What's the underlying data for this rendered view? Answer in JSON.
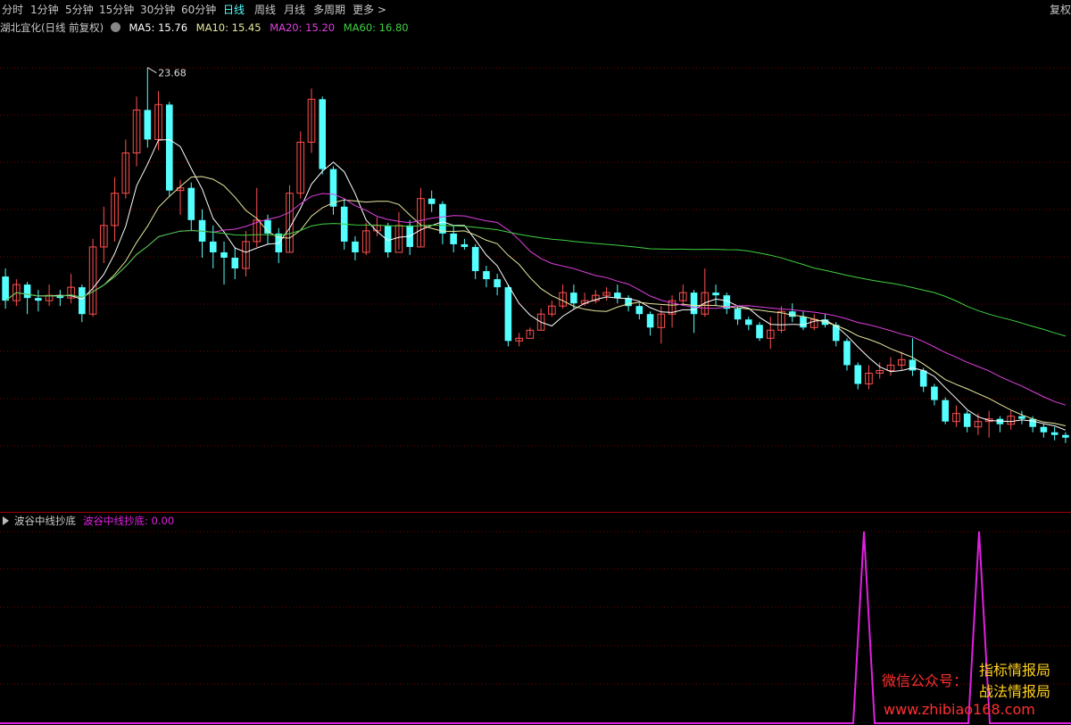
{
  "toolbar": {
    "items": [
      "分时",
      "1分钟",
      "5分钟",
      "15分钟",
      "30分钟",
      "60分钟",
      "日线",
      "周线",
      "月线",
      "多周期",
      "更多 >"
    ],
    "active_index": 6,
    "right_label": "复权"
  },
  "header": {
    "title": "湖北宜化(日线 前复权)",
    "ma5": "MA5: 15.76",
    "ma10": "MA10: 15.45",
    "ma20": "MA20: 15.20",
    "ma60": "MA60: 16.80",
    "colors": {
      "ma5": "#ffffff",
      "ma10": "#e8e8a0",
      "ma20": "#e040e0",
      "ma60": "#40d040"
    }
  },
  "price_annotation": "23.68",
  "indicator": {
    "name": "波谷中线抄底",
    "value_label": "波谷中线抄底: 0.00",
    "color": "#e020e0"
  },
  "watermark": {
    "line1_prefix": "微信公众号：",
    "line1_suffix": "指标情报局",
    "line2": "战法情报局",
    "line3": "www.zhibiao168.com"
  },
  "colors": {
    "up": "#ff5050",
    "down": "#54ffff",
    "bg": "#000000",
    "grid": "#7a0000"
  },
  "icons": [
    "gear-icon",
    "triangle-icon"
  ],
  "chart_data": {
    "type": "candlestick",
    "ma_series": [
      "MA5",
      "MA10",
      "MA20",
      "MA60"
    ],
    "max_price_label": 23.68,
    "indicator_signals": [
      2,
      2
    ],
    "candles": [
      [
        15.9,
        15.0,
        16.2,
        14.7
      ],
      [
        15.0,
        15.6,
        15.8,
        14.8
      ],
      [
        15.6,
        15.1,
        15.7,
        14.5
      ],
      [
        15.1,
        15.0,
        15.4,
        14.6
      ],
      [
        15.0,
        15.2,
        15.6,
        14.8
      ],
      [
        15.2,
        15.1,
        15.4,
        14.8
      ],
      [
        15.1,
        15.5,
        16.0,
        14.9
      ],
      [
        15.5,
        14.5,
        15.6,
        14.2
      ],
      [
        14.5,
        17.0,
        17.3,
        14.4
      ],
      [
        17.0,
        17.8,
        18.5,
        16.4
      ],
      [
        17.8,
        19.0,
        19.6,
        17.2
      ],
      [
        19.0,
        20.5,
        21.0,
        18.8
      ],
      [
        20.5,
        22.1,
        22.6,
        20.0
      ],
      [
        22.1,
        21.0,
        23.68,
        20.7
      ],
      [
        21.0,
        22.3,
        22.8,
        20.6
      ],
      [
        22.3,
        19.1,
        22.4,
        18.9
      ],
      [
        19.1,
        19.2,
        19.5,
        18.2
      ],
      [
        19.2,
        18.0,
        19.4,
        17.6
      ],
      [
        18.0,
        17.2,
        18.4,
        16.6
      ],
      [
        17.2,
        16.8,
        17.8,
        16.2
      ],
      [
        16.8,
        16.6,
        17.2,
        15.6
      ],
      [
        16.6,
        16.2,
        17.0,
        15.8
      ],
      [
        16.2,
        17.2,
        17.6,
        15.9
      ],
      [
        17.2,
        18.0,
        19.2,
        17.0
      ],
      [
        18.0,
        17.5,
        18.2,
        17.1
      ],
      [
        17.5,
        16.8,
        17.7,
        16.4
      ],
      [
        16.8,
        19.0,
        19.3,
        16.8
      ],
      [
        19.0,
        20.9,
        21.3,
        18.8
      ],
      [
        20.9,
        22.5,
        22.9,
        20.5
      ],
      [
        22.5,
        19.9,
        22.6,
        19.7
      ],
      [
        19.9,
        18.5,
        20.0,
        18.2
      ],
      [
        18.5,
        17.2,
        18.8,
        16.9
      ],
      [
        17.2,
        16.8,
        17.4,
        16.5
      ],
      [
        16.8,
        17.6,
        17.9,
        16.7
      ],
      [
        17.6,
        17.8,
        18.1,
        17.4
      ],
      [
        17.8,
        16.8,
        17.9,
        16.6
      ],
      [
        16.8,
        17.8,
        18.3,
        16.9
      ],
      [
        17.8,
        17.0,
        18.0,
        16.7
      ],
      [
        17.0,
        18.8,
        19.2,
        17.0
      ],
      [
        18.8,
        18.6,
        19.1,
        18.3
      ],
      [
        18.6,
        17.5,
        18.7,
        17.1
      ],
      [
        17.5,
        17.1,
        17.8,
        16.8
      ],
      [
        17.1,
        17.0,
        17.3,
        16.9
      ],
      [
        17.0,
        16.1,
        17.1,
        15.8
      ],
      [
        16.1,
        15.8,
        16.3,
        15.5
      ],
      [
        15.8,
        15.5,
        16.0,
        15.2
      ],
      [
        15.5,
        13.5,
        15.6,
        13.3
      ],
      [
        13.5,
        13.6,
        13.8,
        13.3
      ],
      [
        13.6,
        13.9,
        14.0,
        13.7
      ],
      [
        13.9,
        14.5,
        14.7,
        13.9
      ],
      [
        14.5,
        14.8,
        15.0,
        14.4
      ],
      [
        14.8,
        15.3,
        15.6,
        14.7
      ],
      [
        15.3,
        14.9,
        15.6,
        14.7
      ],
      [
        14.9,
        15.0,
        15.3,
        14.8
      ],
      [
        15.0,
        15.2,
        15.4,
        14.9
      ],
      [
        15.2,
        15.3,
        15.5,
        15.0
      ],
      [
        15.3,
        15.1,
        15.6,
        14.9
      ],
      [
        15.1,
        14.8,
        15.2,
        14.6
      ],
      [
        14.8,
        14.5,
        14.9,
        14.3
      ],
      [
        14.5,
        14.0,
        14.6,
        13.7
      ],
      [
        14.0,
        14.5,
        14.8,
        13.4
      ],
      [
        14.5,
        15.0,
        15.2,
        14.0
      ],
      [
        15.0,
        15.3,
        15.6,
        14.8
      ],
      [
        15.3,
        14.5,
        15.4,
        13.8
      ],
      [
        14.5,
        15.3,
        16.2,
        14.4
      ],
      [
        15.3,
        15.2,
        15.6,
        14.8
      ],
      [
        15.2,
        14.7,
        15.3,
        14.5
      ],
      [
        14.7,
        14.3,
        14.8,
        14.1
      ],
      [
        14.3,
        14.1,
        14.4,
        13.9
      ],
      [
        14.1,
        13.6,
        14.2,
        13.5
      ],
      [
        13.6,
        13.9,
        14.4,
        13.2
      ],
      [
        13.9,
        14.6,
        14.8,
        13.8
      ],
      [
        14.6,
        14.4,
        14.9,
        14.2
      ],
      [
        14.4,
        14.0,
        14.6,
        13.9
      ],
      [
        14.0,
        14.3,
        14.5,
        13.9
      ],
      [
        14.3,
        14.1,
        14.5,
        14.0
      ],
      [
        14.1,
        13.5,
        14.2,
        13.3
      ],
      [
        13.5,
        12.6,
        13.6,
        12.4
      ],
      [
        12.6,
        11.9,
        12.7,
        11.7
      ],
      [
        11.9,
        12.3,
        12.6,
        11.7
      ],
      [
        12.3,
        12.4,
        12.7,
        12.1
      ],
      [
        12.4,
        12.6,
        12.9,
        12.2
      ],
      [
        12.6,
        12.8,
        13.1,
        12.4
      ],
      [
        12.8,
        12.4,
        13.6,
        12.2
      ],
      [
        12.4,
        11.8,
        12.5,
        11.6
      ],
      [
        11.8,
        11.3,
        11.9,
        11.1
      ],
      [
        11.3,
        10.5,
        11.4,
        10.4
      ],
      [
        10.5,
        10.8,
        11.1,
        10.3
      ],
      [
        10.8,
        10.3,
        10.9,
        10.1
      ],
      [
        10.3,
        10.5,
        10.8,
        10.0
      ],
      [
        10.5,
        10.6,
        10.9,
        9.9
      ],
      [
        10.6,
        10.4,
        10.7,
        10.1
      ],
      [
        10.4,
        10.7,
        10.9,
        10.2
      ],
      [
        10.7,
        10.6,
        10.9,
        10.4
      ],
      [
        10.6,
        10.3,
        10.7,
        10.1
      ],
      [
        10.3,
        10.1,
        10.4,
        9.9
      ],
      [
        10.1,
        10.0,
        10.3,
        9.8
      ],
      [
        10.0,
        9.9,
        10.1,
        9.7
      ]
    ]
  }
}
